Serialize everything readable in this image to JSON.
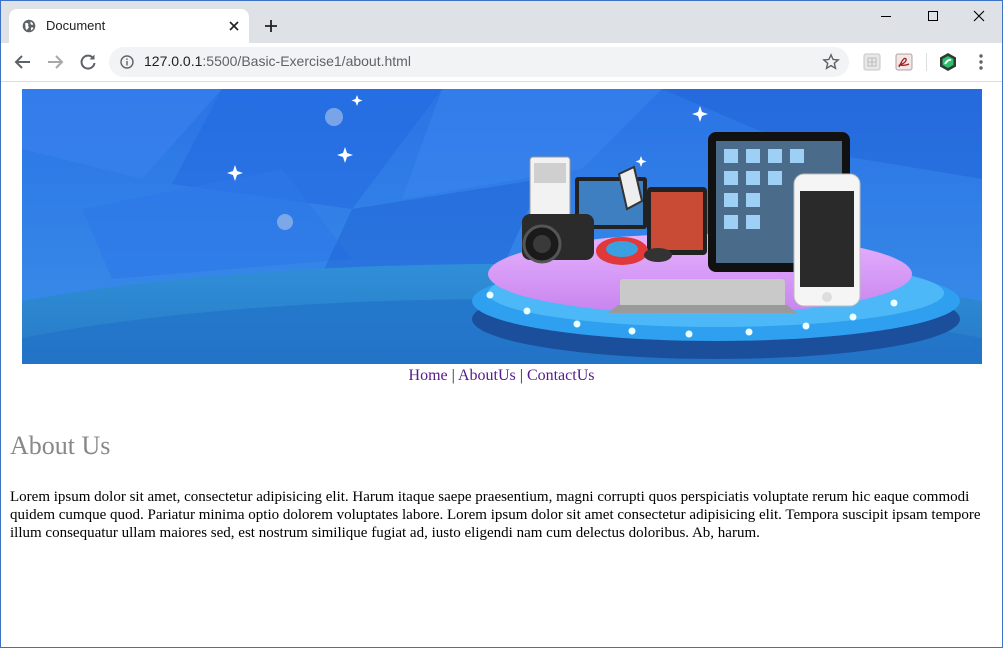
{
  "browser": {
    "tab": {
      "title": "Document",
      "favicon": "globe-icon"
    },
    "address": {
      "prefix": "127.0.0.1",
      "path": ":5500/Basic-Exercise1/about.html"
    },
    "icons": [
      "back-icon",
      "forward-icon",
      "reload-icon",
      "info-icon",
      "star-icon",
      "menu-icon"
    ]
  },
  "page": {
    "nav": {
      "home": "Home",
      "sep1": " | ",
      "about": "AboutUs",
      "sep2": " | ",
      "contact": "ContactUs"
    },
    "heading": "About Us",
    "paragraph": "Lorem ipsum dolor sit amet, consectetur adipisicing elit. Harum itaque saepe praesentium, magni corrupti quos perspiciatis voluptate rerum hic eaque commodi quidem cumque quod. Pariatur minima optio dolorem voluptates labore. Lorem ipsum dolor sit amet consectetur adipisicing elit. Tempora suscipit ipsam tempore illum consequatur ullam maiores sed, est nostrum similique fugiat ad, iusto eligendi nam cum delectus doloribus. Ab, harum."
  },
  "colors": {
    "tabstrip": "#dee1e6",
    "banner": "#2f7fe8",
    "visited_link": "#551a8b",
    "heading": "#888888"
  }
}
